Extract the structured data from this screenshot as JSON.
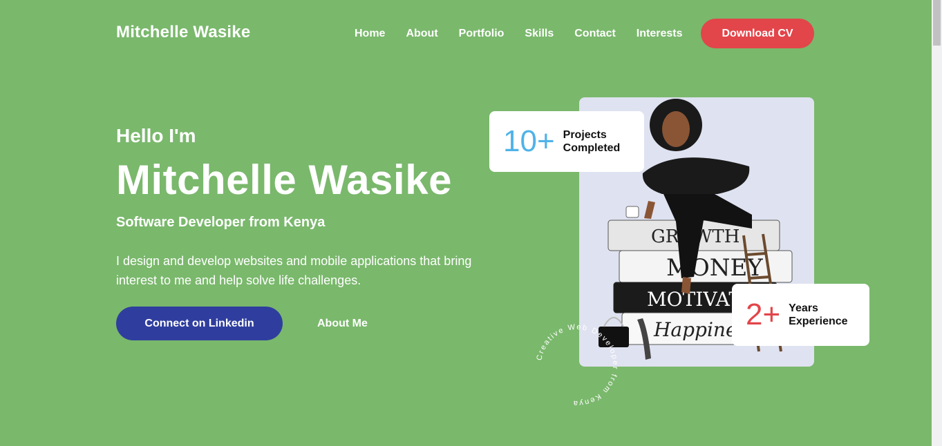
{
  "header": {
    "brand": "Mitchelle Wasike",
    "nav": [
      "Home",
      "About",
      "Portfolio",
      "Skills",
      "Contact",
      "Interests"
    ],
    "cta": "Download CV"
  },
  "hero": {
    "greeting": "Hello I'm",
    "name": "Mitchelle Wasike",
    "role": "Software Developer from Kenya",
    "description": "I design and develop websites and mobile applications that bring interest to me and help solve life challenges.",
    "primary_button": "Connect on Linkedin",
    "secondary_link": "About Me"
  },
  "stats": [
    {
      "number": "10+",
      "line1": "Projects",
      "line2": "Completed"
    },
    {
      "number": "2+",
      "line1": "Years",
      "line2": "Experience"
    }
  ],
  "illustration": {
    "books": [
      "GROWTH",
      "MONEY",
      "MOTIVATI",
      "Happine"
    ]
  },
  "badge_text": "Creative Web Developer from Kenya",
  "colors": {
    "background": "#7ab86c",
    "cta": "#e2454a",
    "linkedin": "#2f3e9e",
    "stat_blue": "#4fb3e8",
    "stat_red": "#e2454a"
  }
}
